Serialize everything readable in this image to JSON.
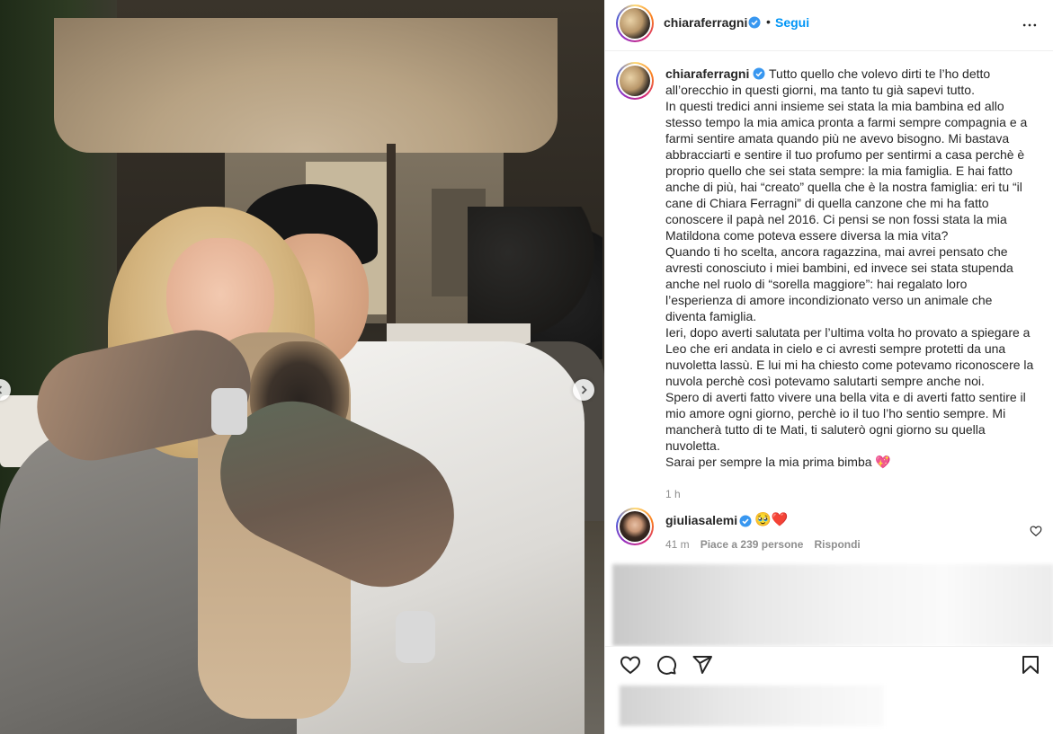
{
  "post": {
    "username": "chiaraferragni",
    "follow_label": "Segui",
    "dot": "•",
    "more_icon": "more-horizontal-icon"
  },
  "caption": {
    "username": "chiaraferragni",
    "text": " Tutto quello che volevo dirti te l’ho detto all’orecchio in questi giorni, ma tanto tu già sapevi tutto.\nIn questi tredici anni insieme sei stata la mia bambina ed allo stesso tempo la mia amica pronta a farmi sempre compagnia e a farmi sentire amata quando più ne avevo bisogno. Mi bastava abbracciarti e sentire il tuo profumo per sentirmi a casa perchè è proprio quello che sei stata sempre: la mia famiglia. E hai fatto anche di più, hai “creato” quella che è la nostra famiglia: eri tu “il cane di Chiara Ferragni” di quella canzone che mi ha fatto conoscere il papà nel 2016. Ci pensi se non fossi stata la mia Matildona come poteva essere diversa la mia vita?\nQuando ti ho scelta, ancora ragazzina, mai avrei pensato che avresti conosciuto i miei bambini, ed invece sei stata stupenda anche nel ruolo di “sorella maggiore”: hai regalato loro l’esperienza di amore incondizionato verso un animale che diventa famiglia.\nIeri, dopo averti salutata per l’ultima volta ho provato a spiegare a Leo che eri andata in cielo e ci avresti sempre protetti da una nuvoletta lassù. E lui mi ha chiesto come potevamo riconoscere la nuvola perchè così potevamo salutarti sempre anche noi.\nSpero di averti fatto vivere una bella vita e di averti fatto sentire il mio amore ogni giorno, perchè io il tuo l’ho sentio sempre. Mi mancherà tutto di te Mati, ti saluterò ogni giorno su quella nuvoletta.\nSarai per sempre la mia prima bimba 💖",
    "time": "1 h"
  },
  "comment": {
    "username": "giuliasalemi",
    "text": "🥹❤️",
    "time": "41 m",
    "likes": "Piace a 239 persone",
    "reply": "Rispondi"
  },
  "icons": {
    "verified": "verified-badge-icon",
    "like": "heart-icon",
    "comment": "comment-bubble-icon",
    "share": "paper-plane-icon",
    "save": "bookmark-icon",
    "next": "chevron-right-icon"
  },
  "colors": {
    "link_blue": "#0095f6",
    "verified_blue": "#3897f0",
    "text": "#262626",
    "muted": "#8e8e8e",
    "heart_emoji": "#e0245e"
  }
}
